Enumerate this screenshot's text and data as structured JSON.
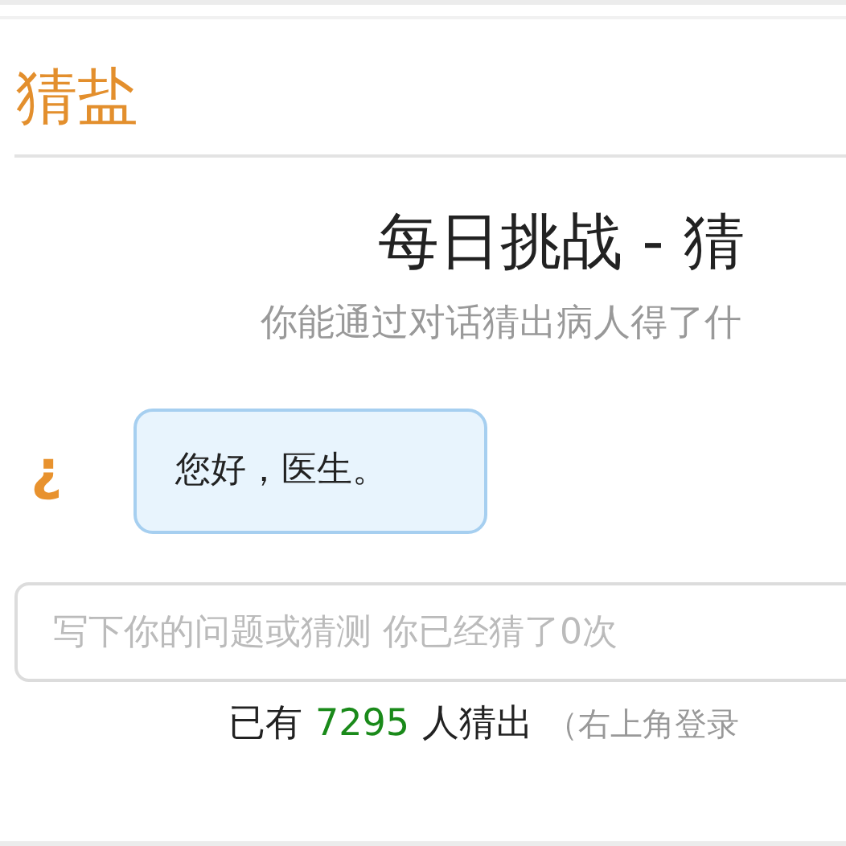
{
  "header": {
    "title": "猜盐"
  },
  "challenge": {
    "title": "每日挑战 - 猜",
    "subtitle": "你能通过对话猜出病人得了什"
  },
  "messages": [
    {
      "kind": "patient",
      "icon": "¿",
      "text": "您好，医生。"
    }
  ],
  "input": {
    "placeholder": "写下你的问题或猜测 你已经猜了0次"
  },
  "stats": {
    "prefix": "已有",
    "count": "7295",
    "suffix": "人猜出",
    "note": "（右上角登录"
  }
}
